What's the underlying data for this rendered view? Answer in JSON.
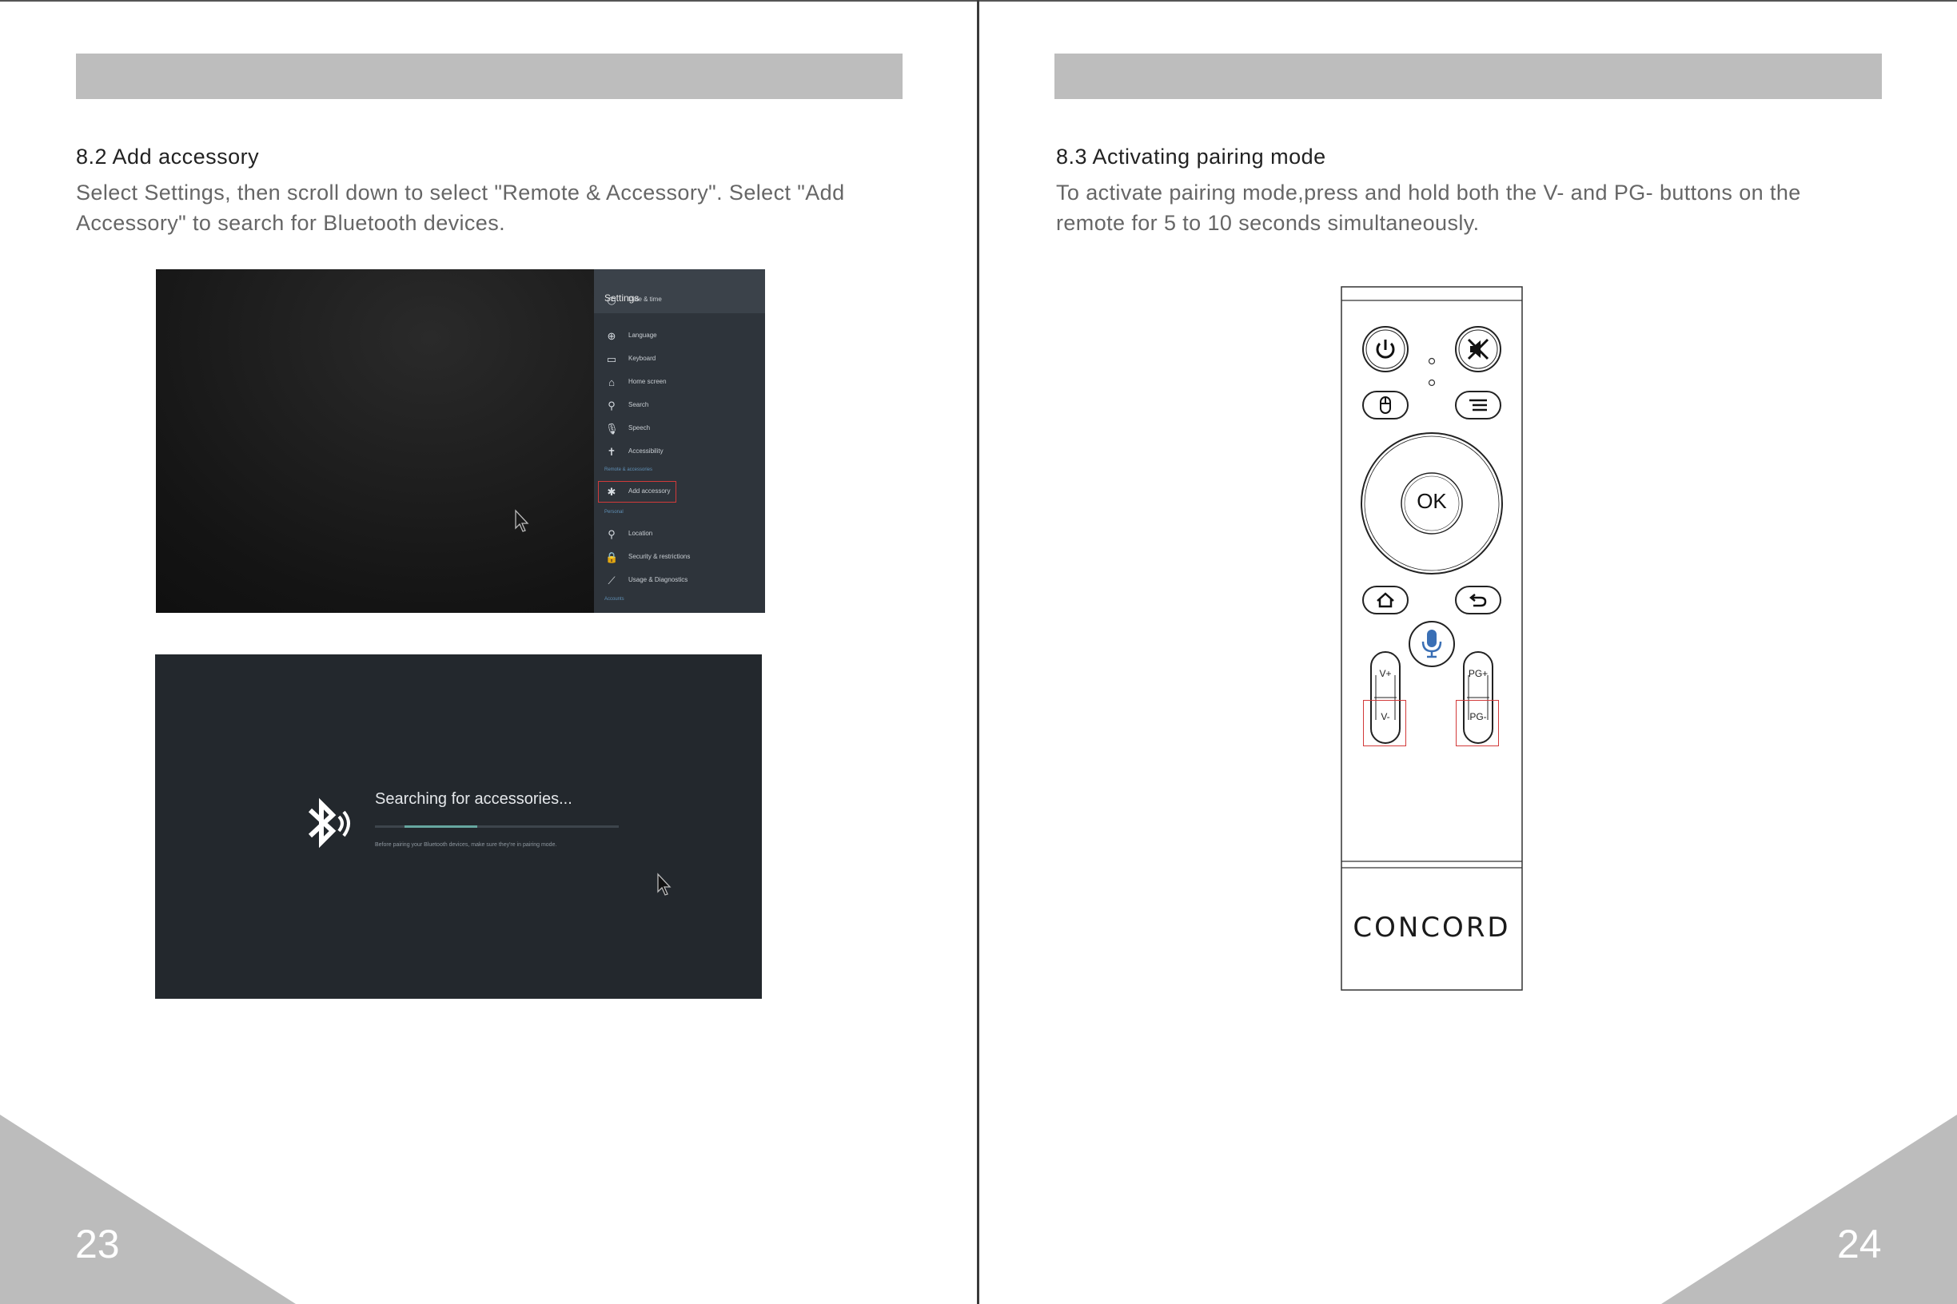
{
  "left_page": {
    "section_title": "8.2  Add accessory",
    "body_line1": "Select Settings, then scroll down to select \"Remote & Accessory\".  Select \"Add",
    "body_line2": "Accessory\" to search for Bluetooth devices.",
    "page_number": "23"
  },
  "right_page": {
    "section_title": "8.3 Activating pairing mode",
    "body_line1": "To activate pairing mode,press and hold both the V- and PG- buttons on the",
    "body_line2": "remote for 5 to 10 seconds simultaneously.",
    "page_number": "24"
  },
  "settings_screenshot": {
    "panel_title": "Settings",
    "items": [
      {
        "icon": "clock-icon",
        "label": "Date & time",
        "glyph": "◷"
      },
      {
        "icon": "globe-icon",
        "label": "Language",
        "glyph": "⊕"
      },
      {
        "icon": "keyboard-icon",
        "label": "Keyboard",
        "glyph": "▭"
      },
      {
        "icon": "home-icon",
        "label": "Home screen",
        "glyph": "⌂"
      },
      {
        "icon": "search-icon",
        "label": "Search",
        "glyph": "⚲"
      },
      {
        "icon": "microphone-icon",
        "label": "Speech",
        "glyph": "🎙"
      },
      {
        "icon": "accessibility-icon",
        "label": "Accessibility",
        "glyph": "✝"
      }
    ],
    "remote_section_label": "Remote & accessories",
    "add_accessory_label": "Add accessory",
    "personal_section_label": "Personal",
    "personal_items": [
      {
        "icon": "location-pin-icon",
        "label": "Location",
        "glyph": "⚲"
      },
      {
        "icon": "lock-icon",
        "label": "Security & restrictions",
        "glyph": "🔒"
      },
      {
        "icon": "chart-line-icon",
        "label": "Usage & Diagnostics",
        "glyph": "⟋"
      }
    ],
    "accounts_section_label": "Accounts"
  },
  "search_screenshot": {
    "status_text": "Searching for accessories...",
    "hint_text": "Before pairing your Bluetooth devices, make sure they're in pairing mode.",
    "progress_fraction": 0.3
  },
  "remote": {
    "ok_label": "OK",
    "vol_up_label": "V+",
    "vol_down_label": "V-",
    "page_up_label": "PG+",
    "page_down_label": "PG-",
    "brand": "CONCORD",
    "highlight_color": "#d23a3a",
    "mic_color": "#3a6fb5"
  }
}
